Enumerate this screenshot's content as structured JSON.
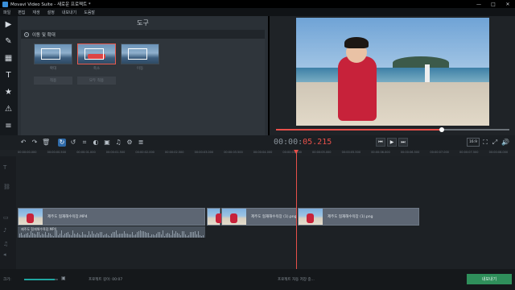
{
  "window": {
    "title": "Movavi Video Suite - 새로운 프로젝트 *",
    "controls": [
      "—",
      "□",
      "✕"
    ]
  },
  "menu": [
    "파일",
    "편집",
    "재생",
    "설정",
    "내보내기",
    "도움말"
  ],
  "tool_rail": [
    {
      "name": "import-icon",
      "glyph": "▶"
    },
    {
      "name": "magic-wand-icon",
      "glyph": "✎"
    },
    {
      "name": "filters-icon",
      "glyph": "▦"
    },
    {
      "name": "titles-icon",
      "glyph": "T"
    },
    {
      "name": "stickers-icon",
      "glyph": "★"
    },
    {
      "name": "shapes-icon",
      "glyph": "⚠"
    },
    {
      "name": "more-tools-icon",
      "glyph": "≡"
    }
  ],
  "tool_panel": {
    "title": "도구",
    "section": "이동 및 확대",
    "presets": [
      {
        "label": "확대",
        "selected": false
      },
      {
        "label": "축소",
        "selected": true
      },
      {
        "label": "이동",
        "selected": false
      }
    ],
    "buttons": [
      "적용",
      "모두 적용"
    ]
  },
  "player": {
    "timecode_main": "00:00:",
    "timecode_ms": "05.215",
    "progress": 0.71,
    "aspect_ratio": "16:9"
  },
  "ruler_ticks": [
    "00:00:00.000",
    "00:00:00.500",
    "00:00:01.000",
    "00:00:01.500",
    "00:00:02.000",
    "00:00:02.500",
    "00:00:03.000",
    "00:00:03.500",
    "00:00:04.000",
    "00:00:04.500",
    "00:00:05.000",
    "00:00:05.500",
    "00:00:06.000",
    "00:00:06.500",
    "00:00:07.000",
    "00:00:07.500",
    "00:00:08.000"
  ],
  "clips": [
    {
      "name": "제주도 협재해수욕장.MP4"
    },
    {
      "name": ""
    },
    {
      "name": "제주도 협재해수욕장 (1).png"
    },
    {
      "name": "제주도 협재해수욕장 (1).png"
    }
  ],
  "audio_clip": {
    "name": "제주도 협재해수욕장.MP4"
  },
  "status": {
    "zoom_label": "크기:",
    "zoom_level": 0.9,
    "duration_label": "프로젝트 길이: 00:07",
    "info": "프로젝트 자동 저장 중...",
    "export_label": "내보내기"
  },
  "colors": {
    "accent": "#e8504a",
    "export": "#2f8f5b",
    "active_tool": "#2f6aa8"
  }
}
